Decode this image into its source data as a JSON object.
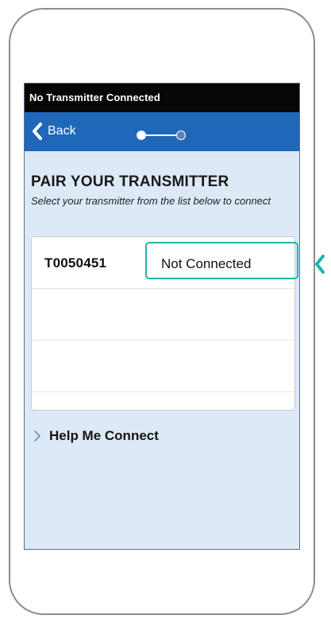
{
  "status_bar": {
    "text": "No Transmitter Connected"
  },
  "navigation": {
    "back_label": "Back",
    "progress_step": 1,
    "progress_total": 2
  },
  "pairing": {
    "title": "PAIR YOUR TRANSMITTER",
    "instructions": "Select your transmitter from the list below to connect",
    "transmitters": [
      {
        "id": "T0050451",
        "status": "Not Connected"
      },
      {
        "id": "",
        "status": ""
      },
      {
        "id": "",
        "status": ""
      }
    ]
  },
  "help": {
    "label": "Help Me Connect"
  },
  "icons": {
    "back": "chevron-left-icon",
    "help": "chevron-right-icon",
    "callout": "chevron-left-icon"
  },
  "colors": {
    "status_bar": "#060606",
    "navigation": "#1f67b8",
    "screen_background": "#dde9f7",
    "highlight": "#20b3ad",
    "link_chevron": "#6f91c8"
  }
}
